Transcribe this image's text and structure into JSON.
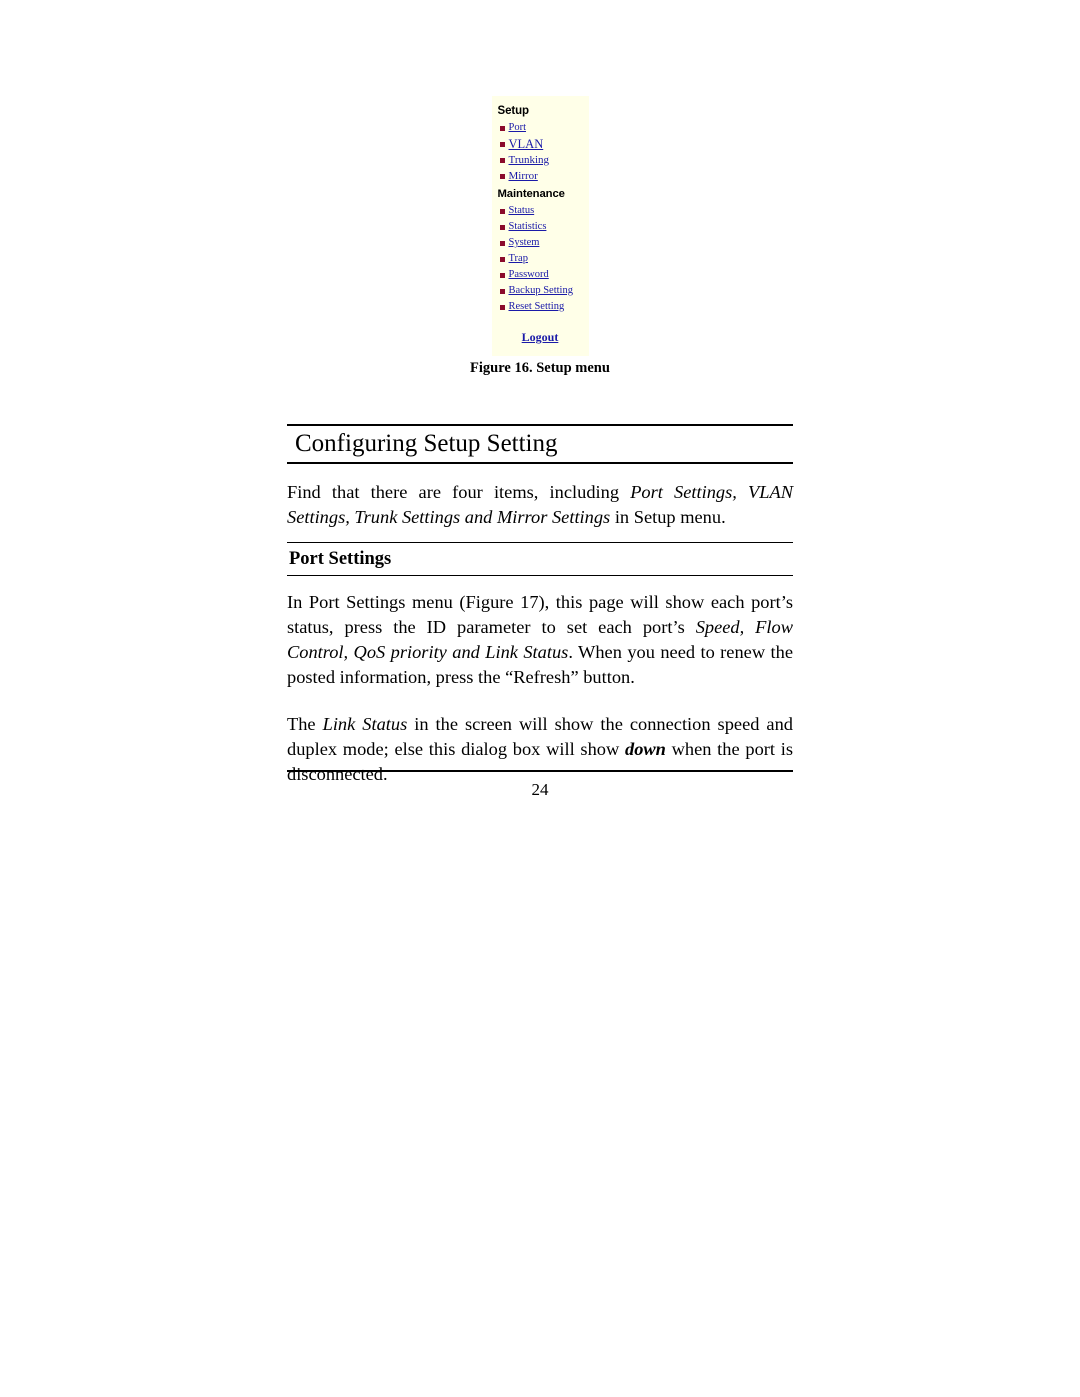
{
  "figure": {
    "panel_bg": "#ffffe8",
    "link_color": "#1a1aa8",
    "bullet_color": "#8b0b2b",
    "groups": [
      {
        "title": "Setup",
        "items": [
          {
            "label": "Port",
            "bullet": "square-bullet-icon"
          },
          {
            "label": "VLAN",
            "bullet": "square-bullet-icon"
          },
          {
            "label": "Trunking",
            "bullet": "square-bullet-icon"
          },
          {
            "label": "Mirror",
            "bullet": "square-bullet-icon"
          }
        ]
      },
      {
        "title": "Maintenance",
        "items": [
          {
            "label": "Status",
            "bullet": "square-bullet-icon"
          },
          {
            "label": "Statistics",
            "bullet": "square-bullet-icon"
          },
          {
            "label": "System",
            "bullet": "square-bullet-icon"
          },
          {
            "label": "Trap",
            "bullet": "square-bullet-icon"
          },
          {
            "label": "Password",
            "bullet": "square-bullet-icon"
          },
          {
            "label": "Backup Setting",
            "bullet": "square-bullet-icon"
          },
          {
            "label": "Reset Setting",
            "bullet": "square-bullet-icon"
          }
        ]
      }
    ],
    "logout_label": "Logout",
    "caption": "Figure 16. Setup menu"
  },
  "content": {
    "chapter_heading": "Configuring Setup Setting",
    "intro_paragraph": {
      "lead": "Find that there are four items, including ",
      "italic": "Port Settings, VLAN Settings, Trunk Settings and Mirror Settings",
      "tail": " in Setup menu."
    },
    "section_heading": "Port Settings",
    "paragraph_port": {
      "part1": "In Port Settings menu (Figure 17), this page will show each port’s status, press the ID parameter to set each port’s ",
      "italic1": "Speed, Flow Control, QoS priority and Link Status",
      "part2": ". When you need to renew the posted information, press the “Refresh” button."
    },
    "paragraph_link": {
      "part1": "The ",
      "italic1": "Link Status",
      "part2": " in the screen will show the connection speed and duplex mode; else this dialog box will show ",
      "bolditalic": "down",
      "part3": " when the port is disconnected."
    }
  },
  "footer": {
    "page_number": "24"
  }
}
